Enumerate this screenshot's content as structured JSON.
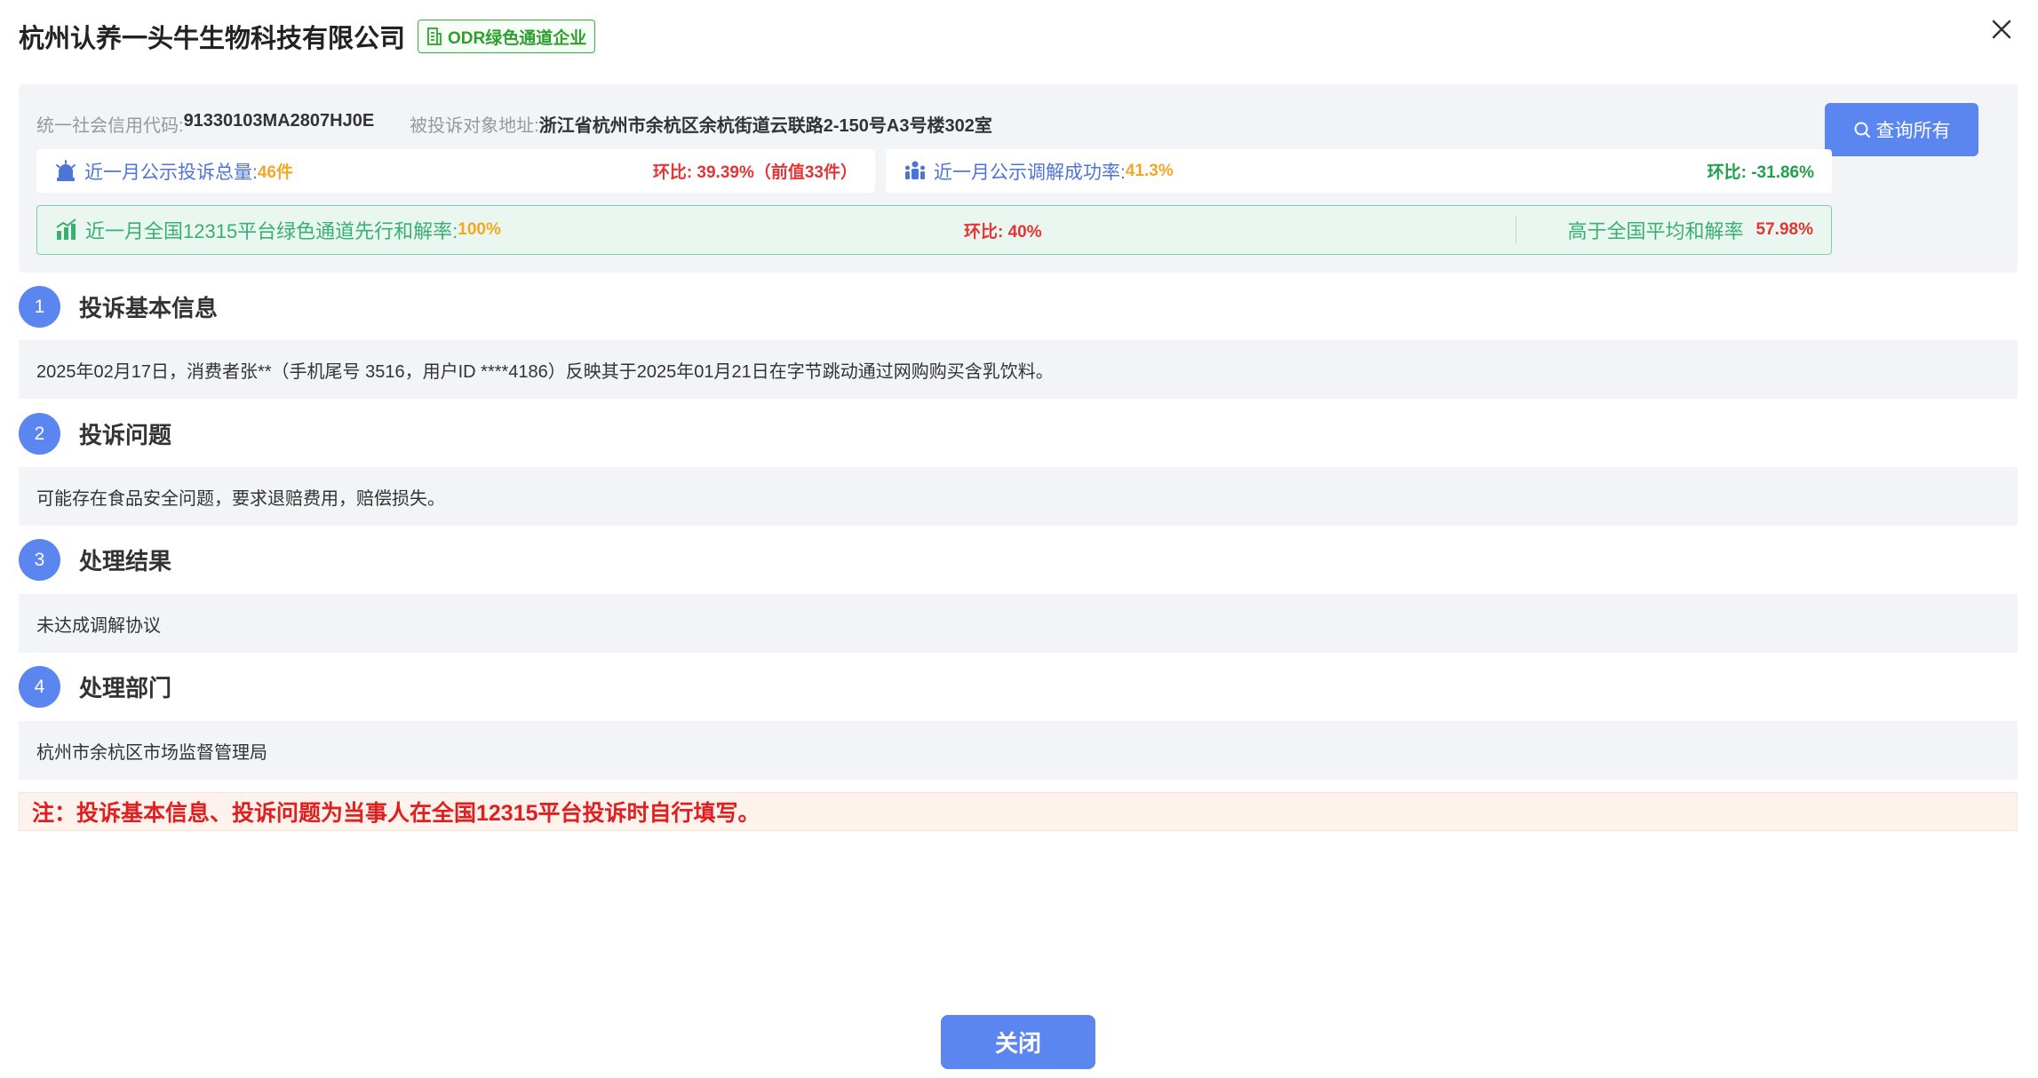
{
  "header": {
    "company_name": "杭州认养一头牛生物科技有限公司",
    "badge_label": "ODR绿色通道企业"
  },
  "summary": {
    "credit_code_label": "统一社会信用代码:",
    "credit_code": "91330103MA2807HJ0E",
    "address_label": "被投诉对象地址:",
    "address": "浙江省杭州市余杭区余杭街道云联路2-150号A3号楼302室",
    "query_button": "查询所有",
    "complaints": {
      "label": "近一月公示投诉总量:",
      "value": "46件",
      "ring": "环比: 39.39%（前值33件）"
    },
    "mediation": {
      "label": "近一月公示调解成功率:",
      "value": "41.3%",
      "ring": "环比: -31.86%"
    },
    "green_channel": {
      "label": "近一月全国12315平台绿色通道先行和解率:",
      "value": "100%",
      "ring": "环比: 40%",
      "above_label": "高于全国平均和解率",
      "above_value": "57.98%"
    }
  },
  "sections": [
    {
      "num": "1",
      "title": "投诉基本信息",
      "body": "2025年02月17日，消费者张**（手机尾号 3516，用户ID ****4186）反映其于2025年01月21日在字节跳动通过网购购买含乳饮料。"
    },
    {
      "num": "2",
      "title": "投诉问题",
      "body": "可能存在食品安全问题，要求退赔费用，赔偿损失。"
    },
    {
      "num": "3",
      "title": "处理结果",
      "body": "未达成调解协议"
    },
    {
      "num": "4",
      "title": "处理部门",
      "body": "杭州市余杭区市场监督管理局"
    }
  ],
  "note": "注：投诉基本信息、投诉问题为当事人在全国12315平台投诉时自行填写。",
  "footer": {
    "close_label": "关闭"
  },
  "colors": {
    "accent": "#5b86f0",
    "badge_green": "#3fae3f",
    "warning_red": "#e02020",
    "value_orange": "#f5a623",
    "positive_green": "#1fa04a"
  },
  "icons": [
    "building-icon",
    "close-icon",
    "search-icon",
    "alarm-bell-icon",
    "people-icon",
    "growth-chart-icon"
  ]
}
